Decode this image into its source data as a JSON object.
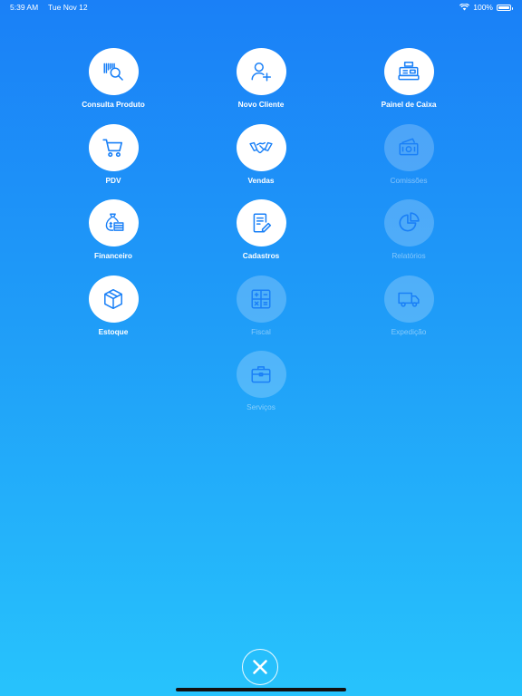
{
  "status_bar": {
    "time": "5:39 AM",
    "date": "Tue Nov 12",
    "battery": "100%"
  },
  "menu": {
    "items": [
      {
        "label": "Consulta Produto",
        "icon": "barcode-search-icon",
        "enabled": true
      },
      {
        "label": "Novo Cliente",
        "icon": "add-user-icon",
        "enabled": true
      },
      {
        "label": "Painel de Caixa",
        "icon": "cash-register-icon",
        "enabled": true
      },
      {
        "label": "PDV",
        "icon": "cart-icon",
        "enabled": true
      },
      {
        "label": "Vendas",
        "icon": "handshake-icon",
        "enabled": true
      },
      {
        "label": "Comissões",
        "icon": "money-icon",
        "enabled": false
      },
      {
        "label": "Financeiro",
        "icon": "money-bag-icon",
        "enabled": true
      },
      {
        "label": "Cadastros",
        "icon": "document-edit-icon",
        "enabled": true
      },
      {
        "label": "Relatórios",
        "icon": "pie-chart-icon",
        "enabled": false
      },
      {
        "label": "Estoque",
        "icon": "box-icon",
        "enabled": true
      },
      {
        "label": "Fiscal",
        "icon": "calculator-icon",
        "enabled": false
      },
      {
        "label": "Expedição",
        "icon": "truck-icon",
        "enabled": false
      },
      {
        "label": "Serviços",
        "icon": "briefcase-icon",
        "enabled": false
      }
    ]
  },
  "colors": {
    "accent": "#1a80f7",
    "background_top": "#1a80f7",
    "background_bottom": "#27c3fc"
  }
}
